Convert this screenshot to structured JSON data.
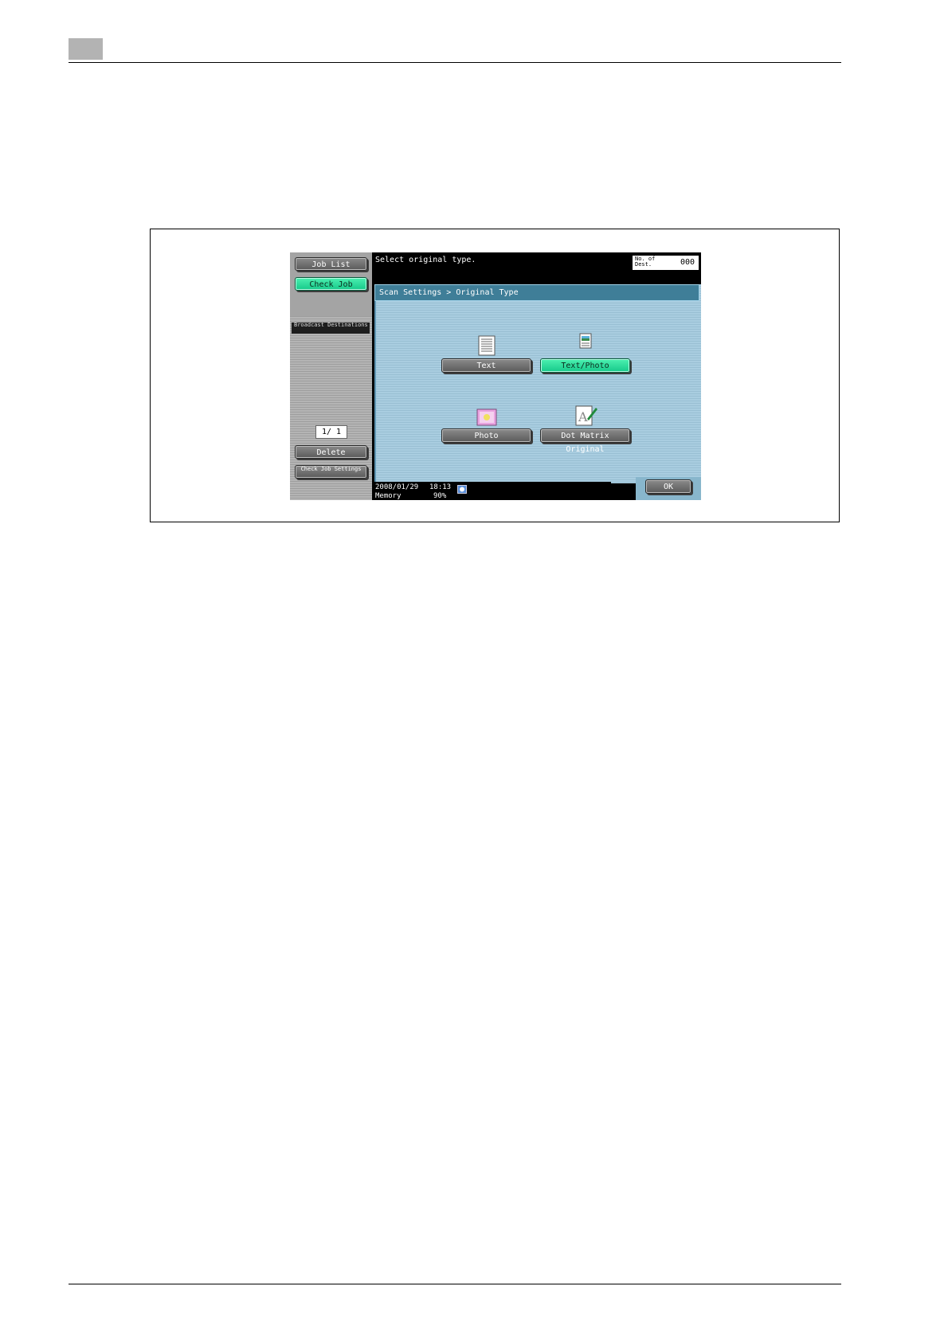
{
  "screen": {
    "left": {
      "job_list_label": "Job List",
      "check_job_label": "Check Job",
      "broadcast_label": "Broadcast Destinations",
      "page_counter": "1/  1",
      "delete_label": "Delete",
      "check_job_settings_label": "Check Job Settings"
    },
    "header": {
      "instruction": "Select original type.",
      "dest_label": "No. of Dest.",
      "dest_count": "000"
    },
    "breadcrumb": "Scan Settings > Original Type",
    "options": [
      {
        "label": "Text",
        "icon": "text-document-icon",
        "selected": false
      },
      {
        "label": "Text/Photo",
        "icon": "text-photo-document-icon",
        "selected": true
      },
      {
        "label": "Photo",
        "icon": "photo-icon",
        "selected": false
      },
      {
        "label": "Dot Matrix Original",
        "icon": "dot-matrix-icon",
        "selected": false
      }
    ],
    "status": {
      "date": "2008/01/29",
      "time": "18:13",
      "memory_label": "Memory",
      "memory_value": "90%"
    },
    "ok_label": "OK",
    "colors": {
      "selected": "#2ee0a0",
      "panel": "#a9cde0",
      "breadcrumb": "#3f7e98"
    }
  }
}
